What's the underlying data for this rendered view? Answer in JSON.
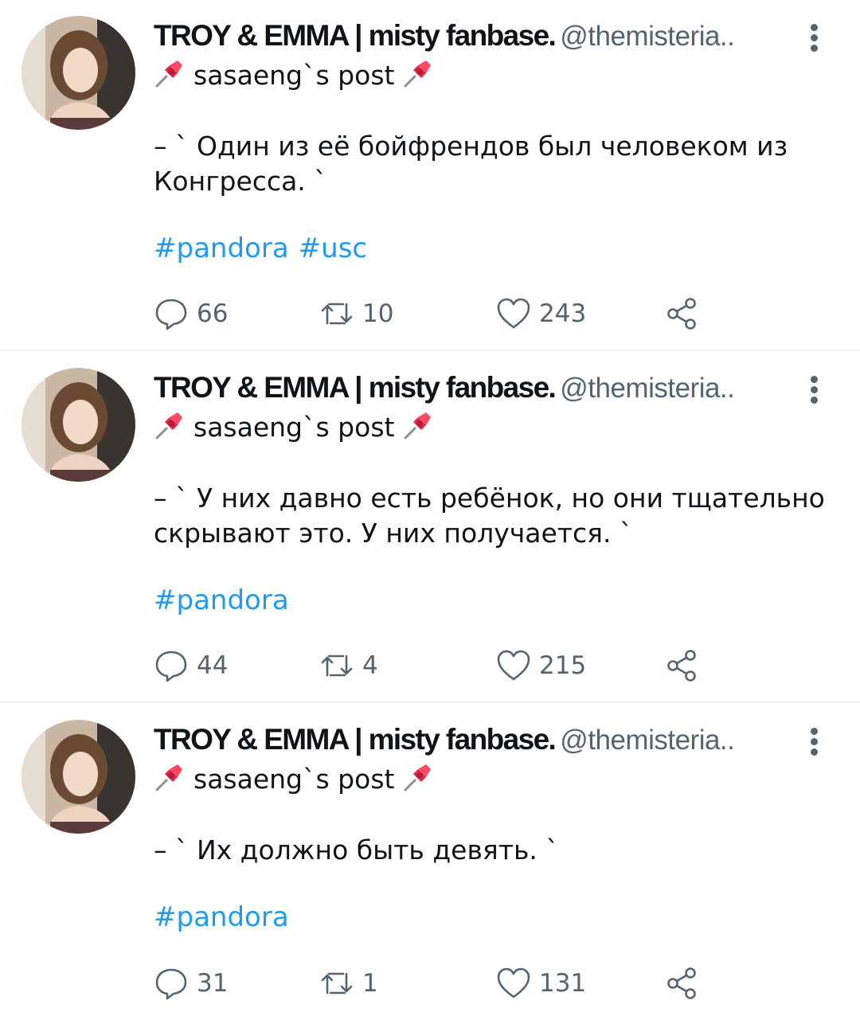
{
  "colors": {
    "text": "#0f1419",
    "secondary": "#536471",
    "link": "#1d9bf0",
    "divider": "#eceff1",
    "pin": "#e0284b"
  },
  "tweets": [
    {
      "author": {
        "name": "TROY & EMMA | misty fanbase.",
        "handle": "@themisteria.."
      },
      "title": "sasaeng`s post",
      "pin_icon": "pushpin-icon",
      "text": "– ` Один из её бойфрендов был человеком из Конгресса. `",
      "hashtags": [
        "#pandora",
        "#usc"
      ],
      "stats": {
        "replies": "66",
        "retweets": "10",
        "likes": "243"
      }
    },
    {
      "author": {
        "name": "TROY & EMMA | misty fanbase.",
        "handle": "@themisteria.."
      },
      "title": "sasaeng`s post",
      "pin_icon": "pushpin-icon",
      "text": "– ` У них давно есть ребёнок, но они тщательно скрывают это. У них получается. `",
      "hashtags": [
        "#pandora"
      ],
      "stats": {
        "replies": "44",
        "retweets": "4",
        "likes": "215"
      }
    },
    {
      "author": {
        "name": "TROY & EMMA | misty fanbase.",
        "handle": "@themisteria.."
      },
      "title": "sasaeng`s post",
      "pin_icon": "pushpin-icon",
      "text": "– ` Их должно быть девять. `",
      "hashtags": [
        "#pandora"
      ],
      "stats": {
        "replies": "31",
        "retweets": "1",
        "likes": "131"
      }
    }
  ]
}
